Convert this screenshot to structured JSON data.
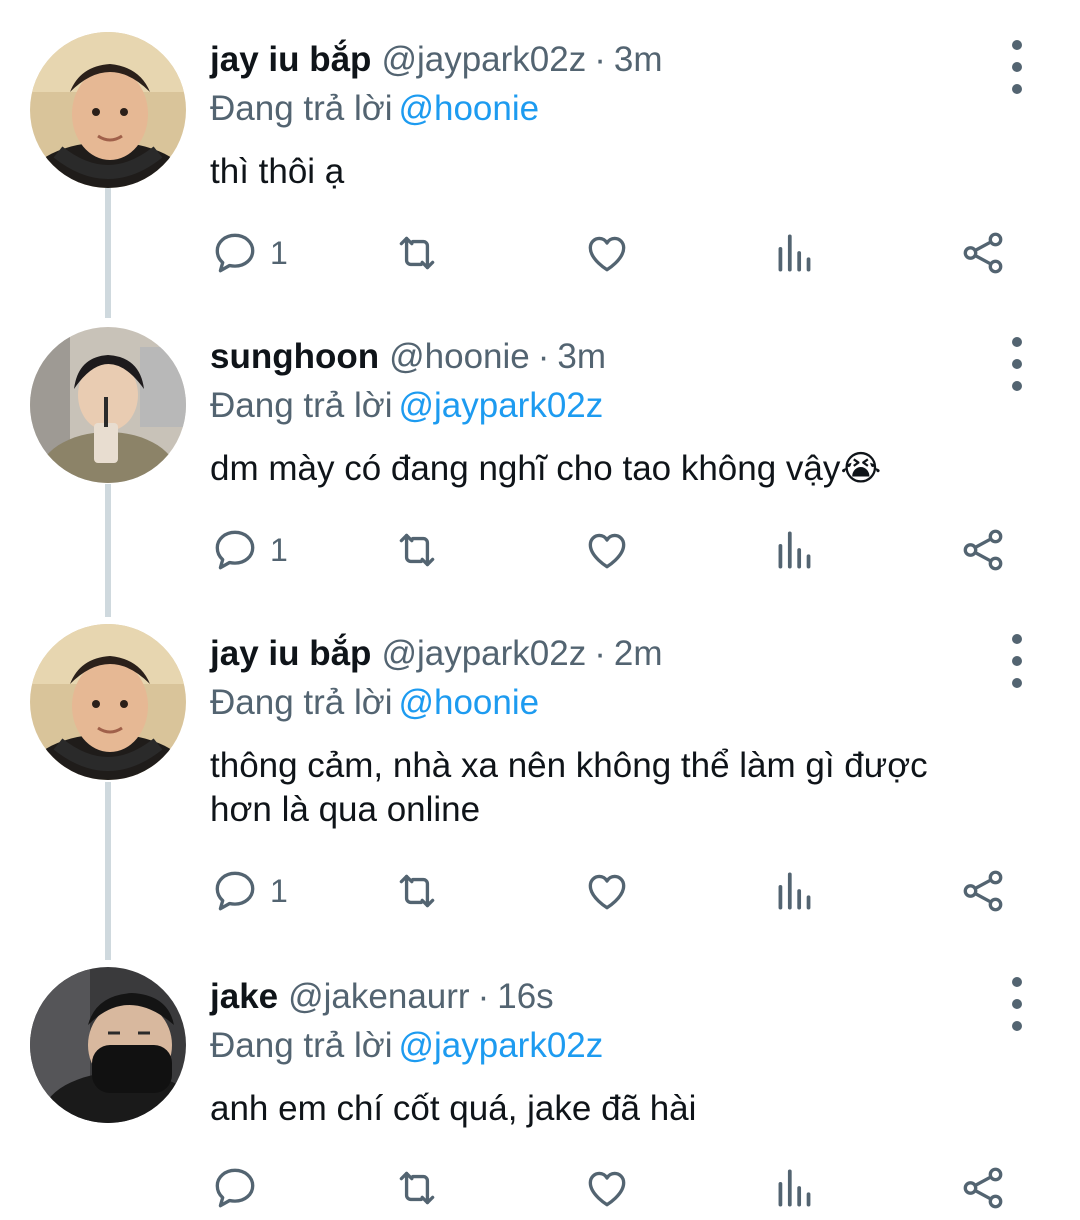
{
  "tweets": [
    {
      "display_name": "jay iu bắp",
      "handle": "@jaypark02z",
      "separator": "·",
      "time": "3m",
      "reply_prefix": "Đang trả lời",
      "reply_to": "@hoonie",
      "text": "thì thôi ạ",
      "reply_count": "1",
      "avatar": "jay-avatar"
    },
    {
      "display_name": "sunghoon",
      "handle": "@hoonie",
      "separator": "·",
      "time": "3m",
      "reply_prefix": "Đang trả lời",
      "reply_to": "@jaypark02z",
      "text": "dm mày có đang nghĩ cho tao không vậy😭",
      "reply_count": "1",
      "avatar": "sunghoon-avatar"
    },
    {
      "display_name": "jay iu bắp",
      "handle": "@jaypark02z",
      "separator": "·",
      "time": "2m",
      "reply_prefix": "Đang trả lời",
      "reply_to": "@hoonie",
      "text": "thông cảm, nhà xa nên không thể làm gì được hơn là qua online",
      "reply_count": "1",
      "avatar": "jay-avatar"
    },
    {
      "display_name": "jake",
      "handle": "@jakenaurr",
      "separator": "·",
      "time": "16s",
      "reply_prefix": "Đang trả lời",
      "reply_to": "@jaypark02z",
      "text": "anh em chí cốt quá, jake đã hài",
      "reply_count": "",
      "avatar": "jake-avatar"
    }
  ],
  "colors": {
    "text_primary": "#0f1419",
    "text_secondary": "#536471",
    "mention": "#1d9bf0",
    "thread_line": "#cfd9de"
  },
  "icons": [
    "reply-icon",
    "retweet-icon",
    "like-icon",
    "views-icon",
    "share-icon",
    "more-icon"
  ]
}
